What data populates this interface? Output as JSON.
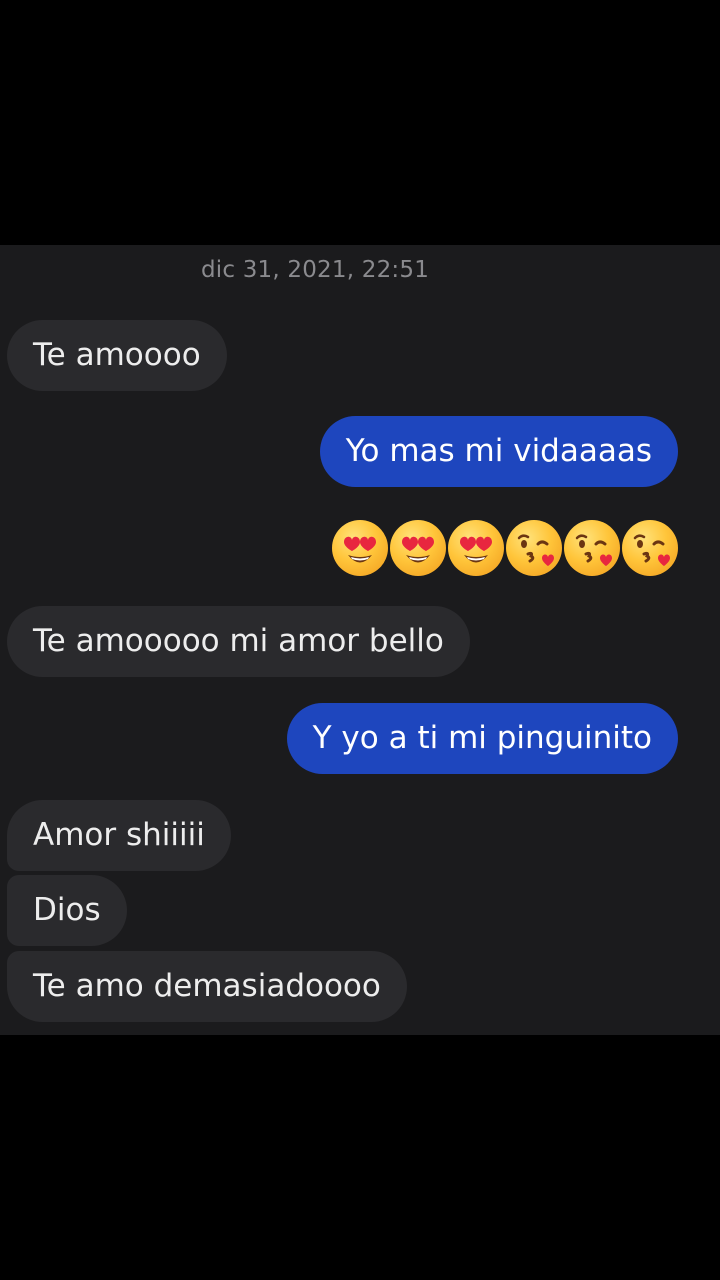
{
  "conversation": {
    "timestamp": "dic 31, 2021, 22:51",
    "messages": [
      {
        "direction": "in",
        "text": "Te amoooo"
      },
      {
        "direction": "out",
        "text": "Yo mas mi vidaaaas"
      },
      {
        "direction": "out",
        "type": "emoji",
        "emojis": [
          "smiling-face-heart-eyes-icon",
          "smiling-face-heart-eyes-icon",
          "smiling-face-heart-eyes-icon",
          "face-blowing-kiss-icon",
          "face-blowing-kiss-icon",
          "face-blowing-kiss-icon"
        ]
      },
      {
        "direction": "in",
        "text": "Te amooooo mi amor bello"
      },
      {
        "direction": "out",
        "text": "Y yo a ti mi pinguinito"
      },
      {
        "direction": "in",
        "text": "Amor shiiiii"
      },
      {
        "direction": "in",
        "text": "Dios"
      },
      {
        "direction": "in",
        "text": "Te amo demasiadoooo"
      }
    ]
  },
  "colors": {
    "background": "#000000",
    "chat_background": "#1b1b1d",
    "incoming_bubble": "#2a2a2d",
    "outgoing_bubble": "#1e46be",
    "timestamp_text": "#8a8a8e"
  }
}
